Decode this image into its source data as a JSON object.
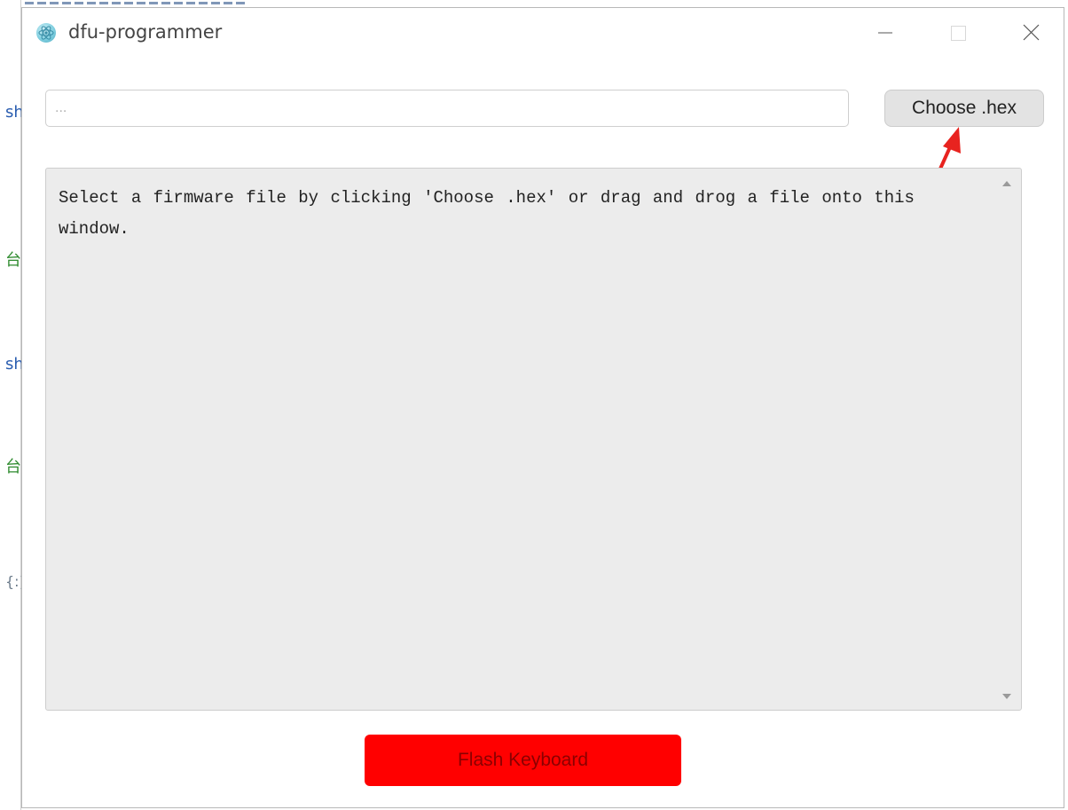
{
  "background_window": {
    "fragments": [
      "sh",
      "台",
      "sh",
      "台",
      "{:}"
    ]
  },
  "window": {
    "title": "dfu-programmer",
    "app_icon": "electron-atom-icon",
    "controls": [
      "minimize-icon",
      "maximize-icon",
      "close-icon"
    ]
  },
  "file_picker": {
    "value": "",
    "placeholder": "...",
    "choose_label": "Choose .hex"
  },
  "log": {
    "message": "Select a firmware file by clicking 'Choose .hex' or drag and drog a file onto this window."
  },
  "actions": {
    "flash_label": "Flash Keyboard"
  },
  "colors": {
    "flash_button": "#ff0000",
    "flash_text": "#8b0000",
    "annotation_arrow": "#e8231f",
    "log_background": "#ececec"
  }
}
